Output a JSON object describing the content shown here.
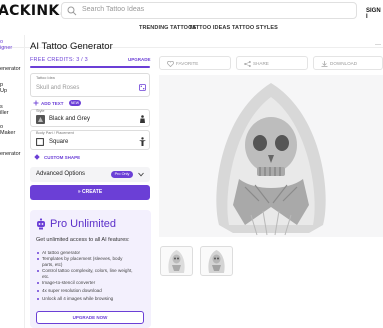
{
  "header": {
    "logo": "ACKINK.AI",
    "search_placeholder": "Search Tattoo Ideas",
    "signin": "SIGN I",
    "nav": [
      "TRENDING TATTOOS",
      "TATTOO IDEAS",
      "TATTOO STYLES"
    ]
  },
  "sidebar": {
    "items": [
      {
        "label": "o",
        "active": true
      },
      {
        "label": "igner",
        "active": true
      },
      {
        "label": "enerator",
        "active": false
      },
      {
        "label": "p",
        "active": false
      },
      {
        "label": "Up",
        "active": false
      },
      {
        "label": "s",
        "active": false
      },
      {
        "label": "iller",
        "active": false
      },
      {
        "label": "o",
        "active": false
      },
      {
        "label": "Maker",
        "active": false
      },
      {
        "label": "enerator",
        "active": false
      }
    ]
  },
  "generator": {
    "title": "AI Tattoo Generator",
    "credits": "FREE CREDITS: 3 / 3",
    "credits_fraction": 1.0,
    "upgrade": "UPGRADE",
    "idea_label": "Tattoo Idea",
    "idea_placeholder": "Skull and Roses",
    "add_text": "ADD TEXT",
    "new_badge": "NEW",
    "style_label": "Style",
    "style_value": "Black and Grey",
    "placement_label": "Body Part / Placement",
    "placement_value": "Square",
    "custom_shape": "CUSTOM SHAPE",
    "advanced_label": "Advanced Options",
    "pro_only": "Pro Only",
    "create": "CREATE"
  },
  "promo": {
    "title": "Pro Unlimited",
    "subtitle": "Get unlimited access to all AI features:",
    "features": [
      "AI tattoo generator",
      "Templates by placement (sleeves, body",
      "parts, etc)",
      "Control tattoo complexity, colors, line weight,",
      "etc.",
      "Image-to-stencil converter",
      "4x super resolution download",
      "Unlock all 4 images while browsing"
    ],
    "button": "UPGRADE NOW"
  },
  "preview": {
    "favorite": "FAVORITE",
    "share": "SHARE",
    "download": "DOWNLOAD"
  },
  "colors": {
    "accent": "#6b3fd6",
    "promo_bg": "#f3f0fd"
  }
}
